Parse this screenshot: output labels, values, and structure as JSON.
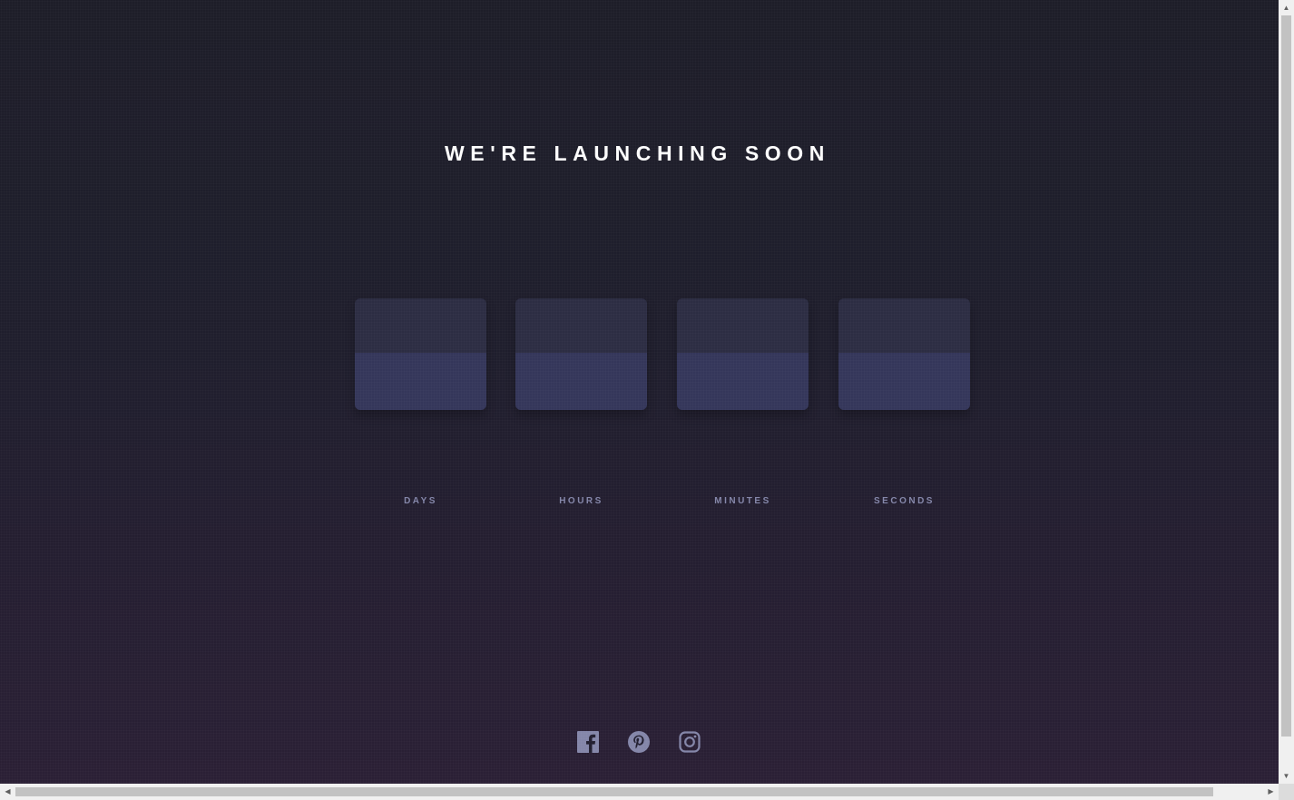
{
  "page": {
    "title": "WE'RE LAUNCHING SOON"
  },
  "countdown": {
    "units": [
      {
        "label": "DAYS"
      },
      {
        "label": "HOURS"
      },
      {
        "label": "MINUTES"
      },
      {
        "label": "SECONDS"
      }
    ]
  },
  "socials": [
    {
      "icon": "facebook-icon"
    },
    {
      "icon": "pinterest-icon"
    },
    {
      "icon": "instagram-icon"
    }
  ],
  "colors": {
    "background_top": "#1d1d28",
    "background_bottom": "#2a1f35",
    "card_top": "#2c2d43",
    "card_bottom": "#34365a",
    "label": "#8486a9",
    "icon": "#8486a9"
  }
}
